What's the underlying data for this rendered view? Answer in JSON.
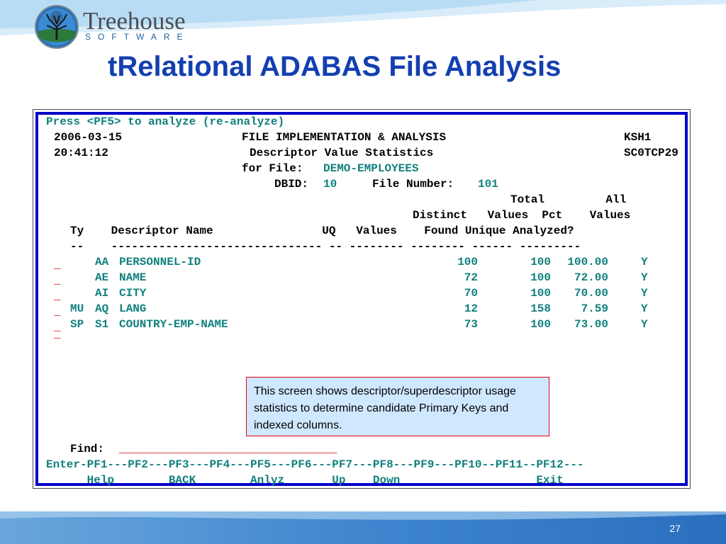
{
  "logo": {
    "name": "Treehouse",
    "tagline": "SOFTWARE"
  },
  "slide": {
    "title": "tRelational ADABAS File Analysis",
    "page_number": "27"
  },
  "terminal": {
    "prompt": "Press <PF5> to analyze (re-analyze)",
    "date": "2006-03-15",
    "time": "20:41:12",
    "heading1": "FILE IMPLEMENTATION & ANALYSIS",
    "heading2": "Descriptor Value Statistics",
    "sys1": "KSH1",
    "sys2": "SC0TCP29",
    "for_file_label": "for File:",
    "file_name": "DEMO-EMPLOYEES",
    "dbid_label": "DBID:",
    "dbid_value": "10",
    "file_number_label": "File Number:",
    "file_number_value": "101",
    "header_lines": {
      "h1": "Total         All",
      "h2": "Distinct   Values  Pct    Values",
      "h3": "Ty    Descriptor Name                UQ   Values    Found Unique Analyzed?",
      "h4": "--    ------------------------------- -- -------- -------- ------ ---------"
    },
    "selection_marker": "_",
    "rows": [
      {
        "ty": "",
        "code": "AA",
        "name": "PERSONNEL-ID",
        "uq": "",
        "distinct": "100",
        "total": "100",
        "pct": "100.00",
        "analyzed": "Y"
      },
      {
        "ty": "",
        "code": "AE",
        "name": "NAME",
        "uq": "",
        "distinct": "72",
        "total": "100",
        "pct": "72.00",
        "analyzed": "Y"
      },
      {
        "ty": "",
        "code": "AI",
        "name": "CITY",
        "uq": "",
        "distinct": "70",
        "total": "100",
        "pct": "70.00",
        "analyzed": "Y"
      },
      {
        "ty": "MU",
        "code": "AQ",
        "name": "LANG",
        "uq": "",
        "distinct": "12",
        "total": "158",
        "pct": "7.59",
        "analyzed": "Y"
      },
      {
        "ty": "SP",
        "code": "S1",
        "name": "COUNTRY-EMP-NAME",
        "uq": "",
        "distinct": "73",
        "total": "100",
        "pct": "73.00",
        "analyzed": "Y"
      }
    ],
    "find_label": "Find:",
    "find_value": "________________________________",
    "pf_keys_line": "Enter-PF1---PF2---PF3---PF4---PF5---PF6---PF7---PF8---PF9---PF10--PF11--PF12---",
    "pf_labels_line": "      Help        BACK        Anlyz       Up    Down                    Exit"
  },
  "note": "This screen shows descriptor/superdescriptor usage statistics to determine candidate Primary Keys and indexed columns."
}
